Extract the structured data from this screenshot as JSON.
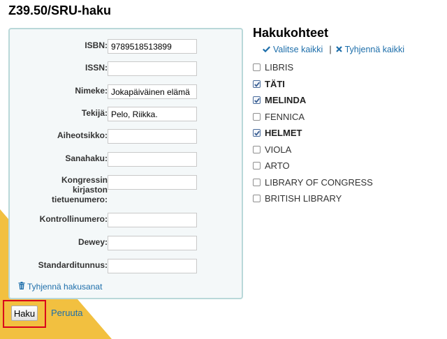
{
  "page": {
    "title": "Z39.50/SRU-haku"
  },
  "form": {
    "fields": [
      {
        "label": "ISBN:",
        "value": "9789518513899"
      },
      {
        "label": "ISSN:",
        "value": ""
      },
      {
        "label": "Nimeke:",
        "value": "Jokapäiväinen elämä"
      },
      {
        "label": "Tekijä:",
        "value": "Pelo, Riikka."
      },
      {
        "label": "Aiheotsikko:",
        "value": ""
      },
      {
        "label": "Sanahaku:",
        "value": ""
      },
      {
        "label": "Kongressin kirjaston tietuenumero:",
        "value": ""
      },
      {
        "label": "Kontrollinumero:",
        "value": ""
      },
      {
        "label": "Dewey:",
        "value": ""
      },
      {
        "label": "Standarditunnus:",
        "value": ""
      }
    ],
    "clear_terms_label": "Tyhjennä hakusanat",
    "clear_icon": "trash-icon"
  },
  "actions": {
    "search_label": "Haku",
    "cancel_label": "Peruuta"
  },
  "targets": {
    "title": "Hakukohteet",
    "select_all_label": "Valitse kaikki",
    "select_all_icon": "check-icon",
    "separator": "|",
    "clear_all_label": "Tyhjennä kaikki",
    "clear_all_icon": "cross-icon",
    "items": [
      {
        "name": "LIBRIS",
        "checked": false
      },
      {
        "name": "TÄTI",
        "checked": true
      },
      {
        "name": "MELINDA",
        "checked": true
      },
      {
        "name": "FENNICA",
        "checked": false
      },
      {
        "name": "HELMET",
        "checked": true
      },
      {
        "name": "VIOLA",
        "checked": false
      },
      {
        "name": "ARTO",
        "checked": false
      },
      {
        "name": "LIBRARY OF CONGRESS",
        "checked": false
      },
      {
        "name": "BRITISH LIBRARY",
        "checked": false
      }
    ]
  },
  "colors": {
    "accent_link": "#1d6eaa",
    "panel_border": "#b9d8d9",
    "panel_background": "#f4f8f9",
    "decor_yellow": "#f2c040",
    "highlight_red": "#d9001b"
  }
}
